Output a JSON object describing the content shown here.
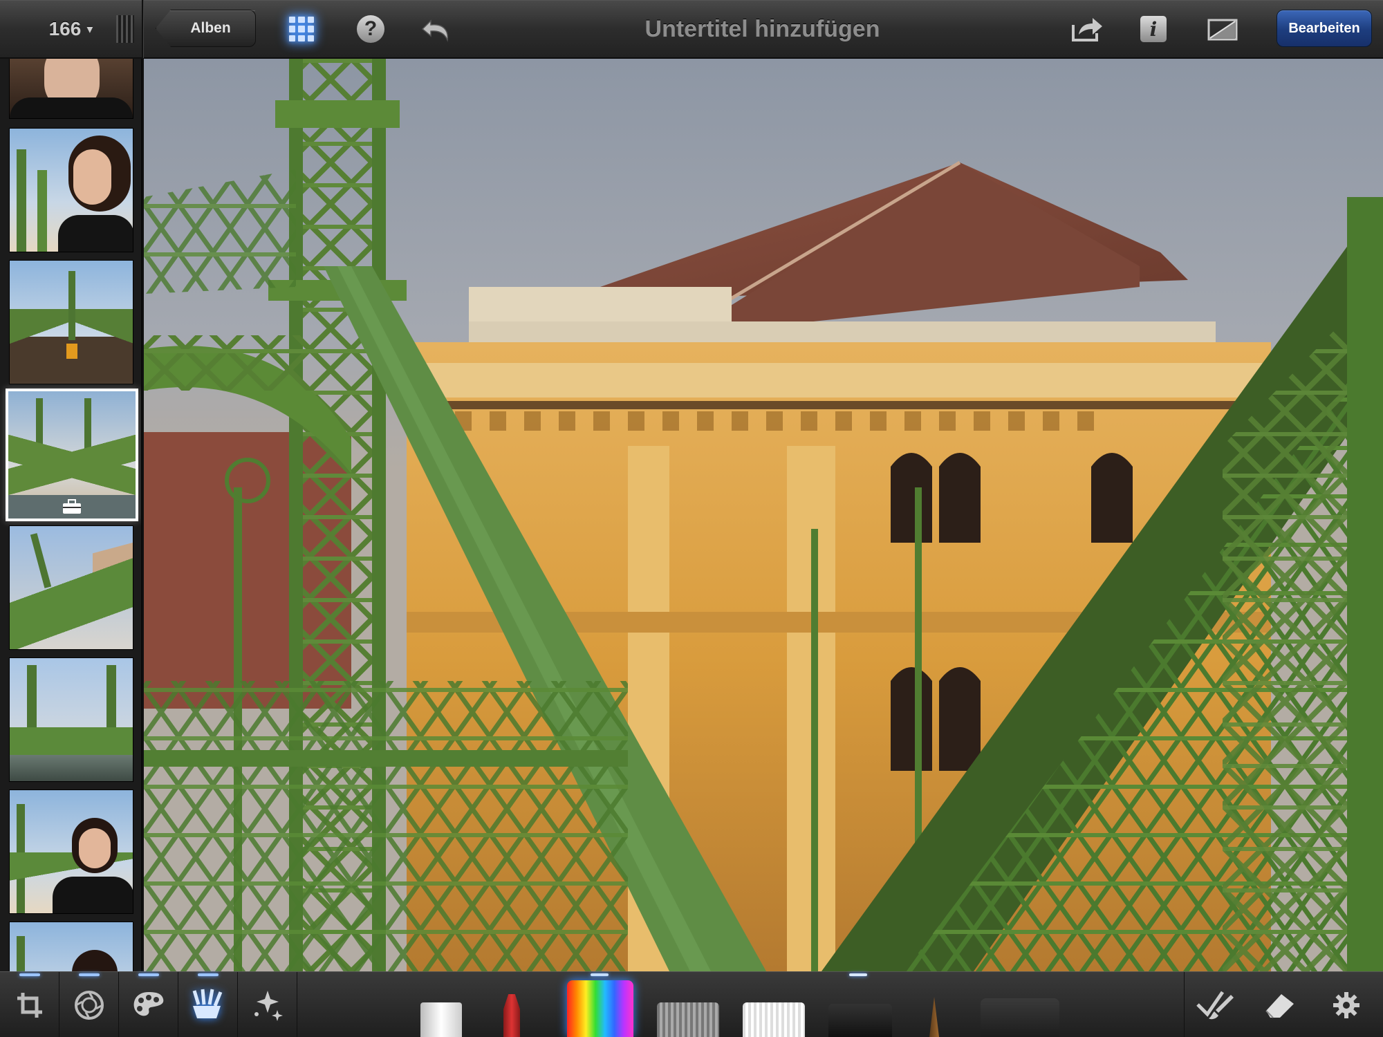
{
  "topbar": {
    "photo_count": "166",
    "count_caret": "▾",
    "back_label": "Alben",
    "title": "Untertitel hinzufügen",
    "edit_label": "Bearbeiten",
    "help_glyph": "?",
    "info_glyph": "i",
    "icons": [
      "grid-icon",
      "help-icon",
      "undo-icon",
      "share-icon",
      "info-icon",
      "compare-icon"
    ]
  },
  "sidebar": {
    "thumbnails": [
      {
        "subject": "woman portrait"
      },
      {
        "subject": "woman profile at bridge"
      },
      {
        "subject": "bridge with tram"
      },
      {
        "subject": "bridge side view",
        "selected": true,
        "badge": "briefcase-icon"
      },
      {
        "subject": "bridge detail"
      },
      {
        "subject": "bridge towers"
      },
      {
        "subject": "woman at bridge"
      },
      {
        "subject": "woman partial"
      }
    ]
  },
  "toolbar": {
    "tools": [
      "crop-icon",
      "exposure-icon",
      "color-palette-icon",
      "brushes-icon",
      "effects-icon"
    ],
    "active_tool": "brushes-icon",
    "brushes": [
      "white-brush",
      "red-pencil",
      "rainbow-brush",
      "gray-brush",
      "white-soft-brush",
      "black-brush",
      "fine-brush",
      "sponge"
    ],
    "right_tools": [
      "paint-brush-check-icon",
      "eraser-icon",
      "gear-icon"
    ]
  },
  "colors": {
    "accent": "#3a8bff",
    "edit_button": "#1d3d7e",
    "bridge_green": "#5f8a3a",
    "building_ochre": "#d9a14a",
    "roof": "#7d4636"
  }
}
